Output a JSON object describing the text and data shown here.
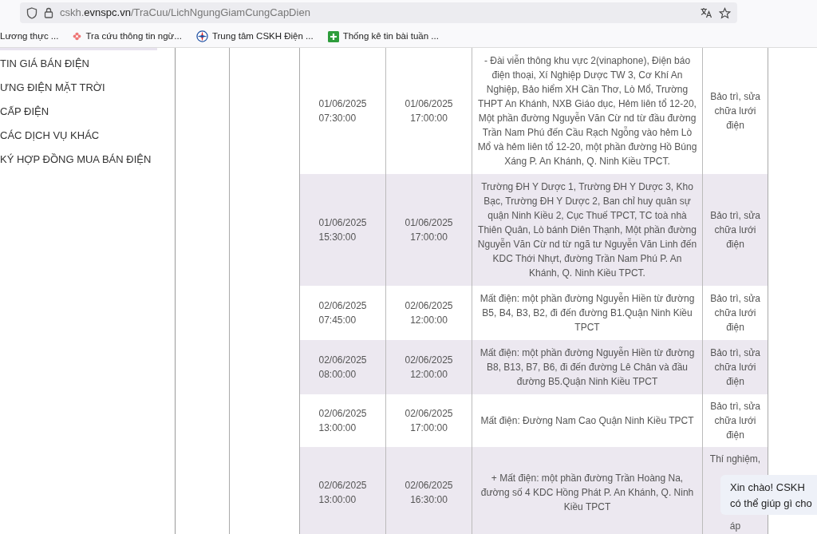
{
  "browser": {
    "url_prefix": "cskh.",
    "url_domain": "evnspc.vn",
    "url_path": "/TraCuu/LichNgungGiamCungCapDien",
    "bookmarks": [
      {
        "label": "Lương thực ...",
        "kind": "none"
      },
      {
        "label": "Tra cứu thông tin ngừ...",
        "kind": "flower"
      },
      {
        "label": "Trung tâm CSKH Điện ...",
        "kind": "compass"
      },
      {
        "label": "Thống kê tin bài tuần ...",
        "kind": "plus"
      }
    ]
  },
  "sidebar": {
    "items": [
      "TIN GIÁ BÁN ĐIỆN",
      "ƯNG ĐIỆN MẶT TRỜI",
      "CẤP ĐIỆN",
      "CÁC DỊCH VỤ KHÁC",
      "KÝ HỢP ĐỒNG MUA BÁN ĐIỆN"
    ]
  },
  "table": {
    "rows": [
      {
        "start": [
          "01/06/2025",
          "07:30:00"
        ],
        "end": [
          "01/06/2025",
          "17:00:00"
        ],
        "area": "- Đài viễn thông khu vực 2(vinaphone), Điện báo điện thoại, Xí Nghiệp Dược TW 3, Cơ Khí An Nghiệp, Bảo hiểm XH Cần Thơ, Lò Mổ, Trường THPT An Khánh, NXB Giáo dục, Hẻm liên tổ 12-20, Một phần đường Nguyễn Văn Cừ nd từ đầu đường Trần Nam Phú đến Cầu Rạch Ngỗng vào hẻm Lò Mổ và hẻm liên tổ 12-20, một phần đường Hồ Búng Xáng P. An Khánh, Q. Ninh Kiều TPCT.",
        "reason": "Bảo trì, sửa chữa lưới điện"
      },
      {
        "start": [
          "01/06/2025",
          "15:30:00"
        ],
        "end": [
          "01/06/2025",
          "17:00:00"
        ],
        "area": "Trường ĐH Y Dược 1, Trường ĐH Y Dược 3, Kho Bạc, Trường ĐH Y Dược 2, Ban chỉ huy quân sự quận Ninh Kiều 2, Cục Thuế TPCT, TC toà nhà Thiên Quân, Lò bánh Diên Thạnh, Một phần đường Nguyễn Văn Cừ nd từ ngã tư Nguyễn Văn Linh đến KDC Thới Nhựt, đường Trần Nam Phú P. An Khánh, Q. Ninh Kiều TPCT.",
        "reason": "Bảo trì, sửa chữa lưới điện"
      },
      {
        "start": [
          "02/06/2025",
          "07:45:00"
        ],
        "end": [
          "02/06/2025",
          "12:00:00"
        ],
        "area": "Mất điện: một phần đường Nguyễn Hiền từ đường B5, B4, B3, B2, đi đến đường B1.Quận Ninh Kiều TPCT",
        "reason": "Bảo trì, sửa chữa lưới điện"
      },
      {
        "start": [
          "02/06/2025",
          "08:00:00"
        ],
        "end": [
          "02/06/2025",
          "12:00:00"
        ],
        "area": "Mất điện: một phần đường Nguyễn Hiền từ đường B8, B13, B7, B6, đi đến đường Lê Chân và đầu đường B5.Quận Ninh Kiều TPCT",
        "reason": "Bảo trì, sửa chữa lưới điện"
      },
      {
        "start": [
          "02/06/2025",
          "13:00:00"
        ],
        "end": [
          "02/06/2025",
          "17:00:00"
        ],
        "area": "Mất điện: Đường Nam Cao Quận Ninh Kiều TPCT",
        "reason": "Bảo trì, sửa chữa lưới điện"
      },
      {
        "start": [
          "02/06/2025",
          "13:00:00"
        ],
        "end": [
          "02/06/2025",
          "16:30:00"
        ],
        "area": "+ Mất điện: một phần đường Trần Hoàng Na, đường số 4 KDC Hồng Phát P. An Khánh, Q. Ninh Kiều TPCT",
        "reason_lines": [
          "Thí nghiệm,",
          "áp"
        ]
      }
    ]
  },
  "chat": {
    "lines": [
      "Xin chào! CSKH",
      "có thể giúp gì cho"
    ]
  }
}
